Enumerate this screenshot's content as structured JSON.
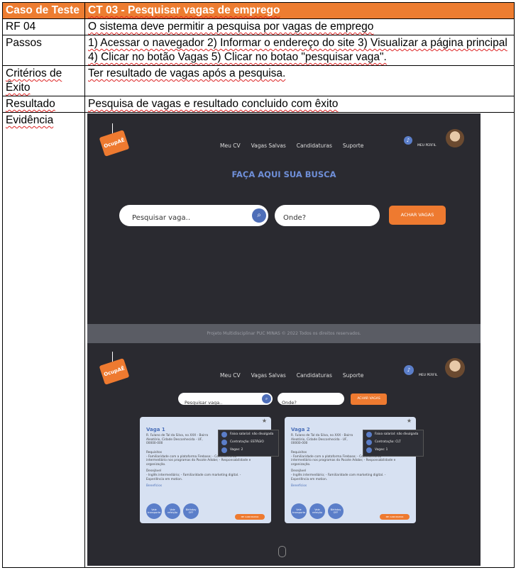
{
  "table": {
    "header_label": "Caso de Teste",
    "header_value": "CT 03 - Pesquisar vagas de emprego",
    "rows": [
      {
        "label": "RF 04",
        "value": "O sistema deve permitir a pesquisa por vagas de emprego"
      },
      {
        "label": "Passos",
        "value": "1) Acessar o navegador 2) Informar o endereço do site 3) Visualizar a página principal 4) Clicar no botão Vagas 5) Clicar no botao \"pesquisar vaga\"."
      },
      {
        "label": "Critérios de Êxito",
        "value": "Ter resultado de vagas após a pesquisa."
      },
      {
        "label": "Resultado",
        "value": "Pesquisa de vagas e resultado concluido com êxito"
      },
      {
        "label": "Evidência"
      }
    ]
  },
  "screenshot": {
    "logo_text": "OcupAÊ",
    "nav": [
      "Meu CV",
      "Vagas Salvas",
      "Candidaturas",
      "Suporte"
    ],
    "profile_label": "MEU PERFIL",
    "headline": "FAÇA AQUI SUA BUSCA",
    "search_placeholder": "Pesquisar vaga..",
    "where_placeholder": "Onde?",
    "search_button": "ACHAR VAGAS",
    "footer": "Projeto Multidisciplinar PUC MINAS © 2022 Todos os direitos reservados.",
    "colors": {
      "accent": "#ee7a30",
      "blue": "#4e6eb8",
      "header": "#ED7D31",
      "background": "#2a2a30"
    },
    "cards": [
      {
        "title": "Vaga 1",
        "address": "R. Fulano de Tal da Silva, no XXX - Bairro Aleatório, Cidade Desconhecida - UF, 00000-000",
        "requisitos_title": "Requisitos",
        "requisitos": "- Familiaridade com a plataforma Firebase; - Conhecimento intermediário nos programas do Pacote Adobe; - Responsabilidade e organização.",
        "desejavel_title": "Desejável",
        "desejavel": "- Inglês intermediário; - Familiaridade com marketing digital. - Experiência em motion.",
        "beneficios_title": "Benefícios",
        "benefits": [
          "Vale transporte",
          "Vale refeição",
          "Birthday OFF"
        ],
        "info": [
          "Faixa salarial: não divulgada",
          "Contratação: ESTÁGIO",
          "Vagas: 2"
        ],
        "button": "ME CANDIDATAR"
      },
      {
        "title": "Vaga 2",
        "address": "R. Fulano de Tal da Silva, no XXX - Bairro Aleatório, Cidade Desconhecida - UF, 00000-000",
        "requisitos_title": "Requisitos",
        "requisitos": "- Familiaridade com a plataforma Firebase; - Conhecimento intermediário nos programas do Pacote Adobe; - Responsabilidade e organização.",
        "desejavel_title": "Desejável",
        "desejavel": "- Inglês intermediário; - Familiaridade com marketing digital. - Experiência em motion.",
        "beneficios_title": "Benefícios",
        "benefits": [
          "Vale transporte",
          "Vale refeição",
          "Birthday OFF"
        ],
        "info": [
          "Faixa salarial: não divulgada",
          "Contratação: CLT",
          "Vagas: 1"
        ],
        "button": "ME CANDIDATAR"
      }
    ]
  }
}
